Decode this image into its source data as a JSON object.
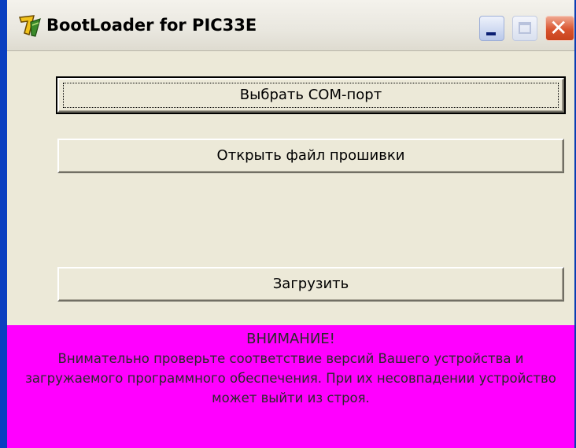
{
  "window": {
    "title": "BootLoader for PIC33E",
    "controls": {
      "minimize": "minimize",
      "maximize": "maximize",
      "close": "✕"
    }
  },
  "buttons": {
    "select_port": "Выбрать COM-порт",
    "open_firmware": "Открыть файл прошивки",
    "upload": "Загрузить"
  },
  "warning": {
    "heading": "ВНИМАНИЕ!",
    "text": "Внимательно проверьте соответствие версий Вашего устройства и загружаемого программного обеспечения. При их несовпадении устройство может выйти из строя."
  },
  "colors": {
    "warning_background": "#ff00ff",
    "window_face": "#ece9d8",
    "frame_blue": "#0a3fc0"
  },
  "icons": {
    "app": "delphi-app-icon",
    "minimize": "minimize-icon",
    "maximize": "maximize-icon",
    "close": "close-icon"
  }
}
